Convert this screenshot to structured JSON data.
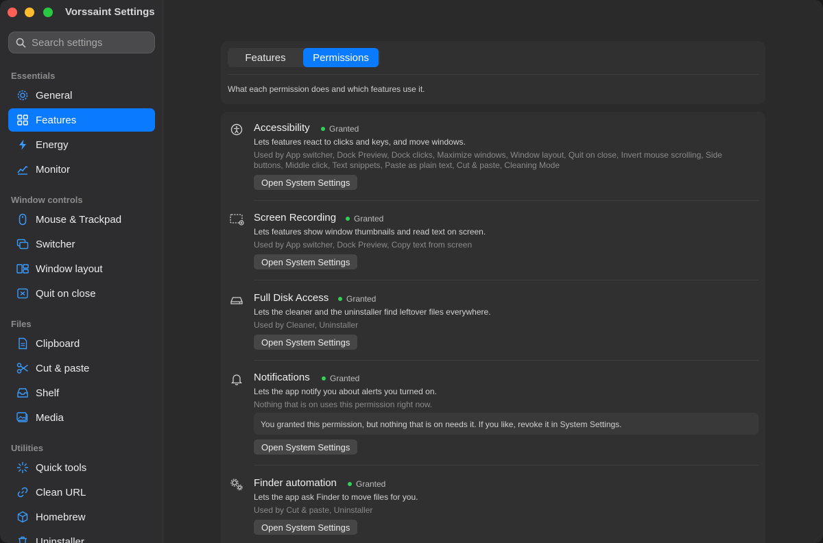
{
  "app": {
    "title": "Vorssaint Settings"
  },
  "search": {
    "placeholder": "Search settings"
  },
  "sidebar": {
    "groups": [
      {
        "label": "Essentials",
        "items": [
          {
            "label": "General",
            "icon": "gear-icon"
          },
          {
            "label": "Features",
            "icon": "grid-icon",
            "active": true
          },
          {
            "label": "Energy",
            "icon": "bolt-icon"
          },
          {
            "label": "Monitor",
            "icon": "chart-line-icon"
          }
        ]
      },
      {
        "label": "Window controls",
        "items": [
          {
            "label": "Mouse & Trackpad",
            "icon": "mouse-icon"
          },
          {
            "label": "Switcher",
            "icon": "windows-stack-icon"
          },
          {
            "label": "Window layout",
            "icon": "layout-icon"
          },
          {
            "label": "Quit on close",
            "icon": "close-square-icon"
          }
        ]
      },
      {
        "label": "Files",
        "items": [
          {
            "label": "Clipboard",
            "icon": "document-icon"
          },
          {
            "label": "Cut & paste",
            "icon": "scissors-icon"
          },
          {
            "label": "Shelf",
            "icon": "tray-icon"
          },
          {
            "label": "Media",
            "icon": "photo-icon"
          }
        ]
      },
      {
        "label": "Utilities",
        "items": [
          {
            "label": "Quick tools",
            "icon": "sparkle-icon"
          },
          {
            "label": "Clean URL",
            "icon": "link-icon"
          },
          {
            "label": "Homebrew",
            "icon": "cube-icon"
          },
          {
            "label": "Uninstaller",
            "icon": "trash-icon"
          }
        ]
      }
    ]
  },
  "tabs": [
    {
      "label": "Features",
      "active": false
    },
    {
      "label": "Permissions",
      "active": true
    }
  ],
  "page": {
    "description": "What each permission does and which features use it."
  },
  "permissions": [
    {
      "title": "Accessibility",
      "status": "Granted",
      "icon": "accessibility-icon",
      "description": "Lets features react to clicks and keys, and move windows.",
      "used_by_line1": "Used by App switcher, Dock Preview, Dock clicks, Maximize windows, Window layout, Quit on close, Invert mouse scrolling, Side",
      "used_by_line2": "buttons, Middle click, Text snippets, Paste as plain text, Cut & paste, Cleaning Mode",
      "button": "Open System Settings"
    },
    {
      "title": "Screen Recording",
      "status": "Granted",
      "icon": "screen-recording-icon",
      "description": "Lets features show window thumbnails and read text on screen.",
      "used_by_line1": "Used by App switcher, Dock Preview, Copy text from screen",
      "button": "Open System Settings"
    },
    {
      "title": "Full Disk Access",
      "status": "Granted",
      "icon": "disk-icon",
      "description": "Lets the cleaner and the uninstaller find leftover files everywhere.",
      "used_by_line1": "Used by Cleaner, Uninstaller",
      "button": "Open System Settings"
    },
    {
      "title": "Notifications",
      "status": "Granted",
      "icon": "bell-icon",
      "description": "Lets the app notify you about alerts you turned on.",
      "used_by_line1": "Nothing that is on uses this permission right now.",
      "note": "You granted this permission, but nothing that is on needs it. If you like, revoke it in System Settings.",
      "button": "Open System Settings"
    },
    {
      "title": "Finder automation",
      "status": "Granted",
      "icon": "gears-icon",
      "description": "Lets the app ask Finder to move files for you.",
      "used_by_line1": "Used by Cut & paste, Uninstaller",
      "button": "Open System Settings"
    }
  ],
  "colors": {
    "accent": "#0a7aff",
    "granted": "#2fd158",
    "background": "#2a2a2a"
  }
}
